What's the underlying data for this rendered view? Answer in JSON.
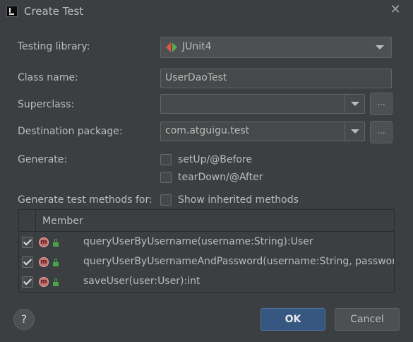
{
  "window": {
    "title": "Create Test"
  },
  "form": {
    "testing_library_label": "Testing library:",
    "testing_library_value": "JUnit4",
    "class_name_label": "Class name:",
    "class_name_value": "UserDaoTest",
    "superclass_label": "Superclass:",
    "superclass_value": "",
    "destination_label": "Destination package:",
    "destination_value": "com.atguigu.test",
    "browse_label": "...",
    "generate_label": "Generate:",
    "setup_label": "setUp/@Before",
    "setup_checked": false,
    "teardown_label": "tearDown/@After",
    "teardown_checked": false,
    "methods_label": "Generate test methods for:",
    "inherited_label": "Show inherited methods",
    "inherited_checked": false
  },
  "table": {
    "header": "Member",
    "rows": [
      {
        "checked": true,
        "icon": "method-icon",
        "text": "queryUserByUsername(username:String):User"
      },
      {
        "checked": true,
        "icon": "method-icon",
        "text": "queryUserByUsernameAndPassword(username:String, password:String):User"
      },
      {
        "checked": true,
        "icon": "method-icon",
        "text": "saveUser(user:User):int"
      }
    ],
    "method_icon_letter": "m"
  },
  "footer": {
    "help_label": "?",
    "ok_label": "OK",
    "cancel_label": "Cancel"
  },
  "colors": {
    "background": "#3c3f41",
    "field": "#45494a",
    "ok_button": "#365880",
    "method_icon": "#c6716e",
    "junit_red": "#e0553a",
    "junit_green": "#5ba84e"
  }
}
